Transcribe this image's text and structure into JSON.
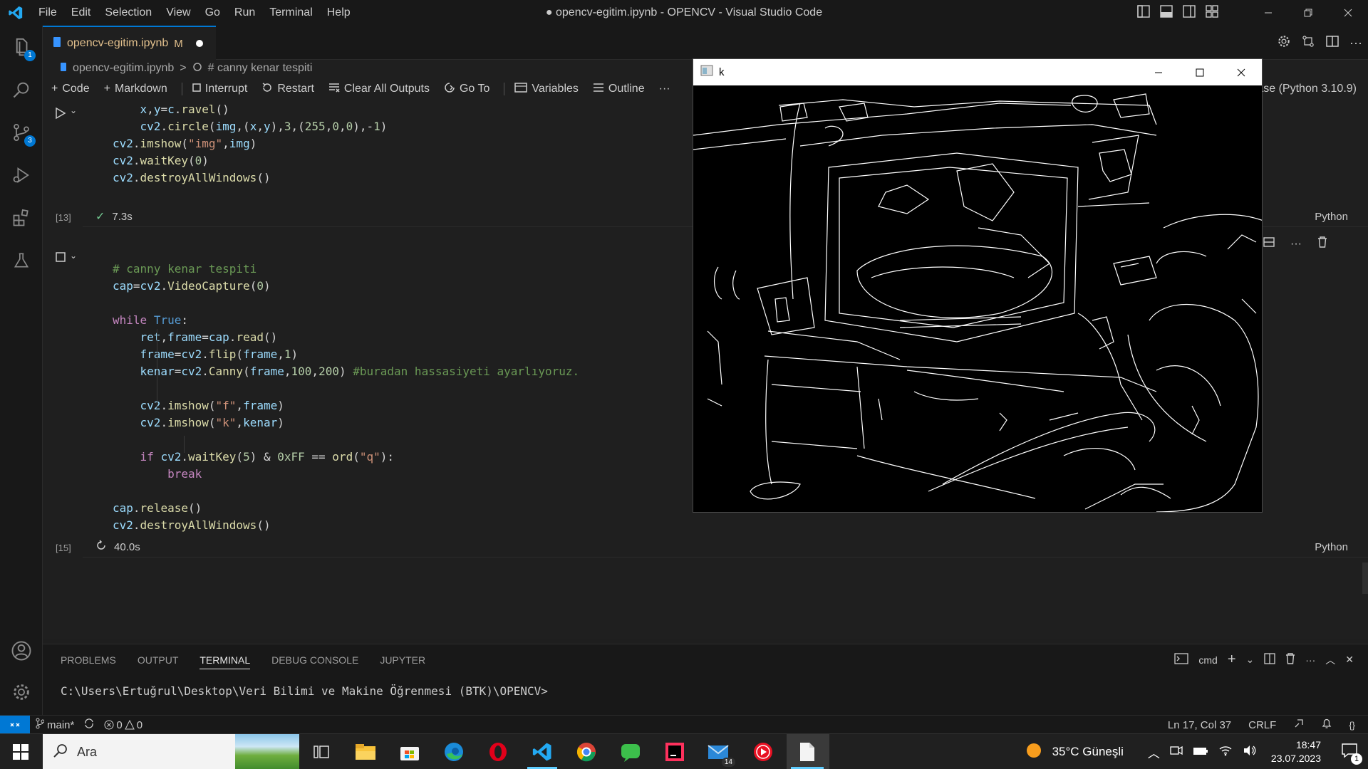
{
  "window": {
    "title": "● opencv-egitim.ipynb - OPENCV - Visual Studio Code",
    "menu": [
      "File",
      "Edit",
      "Selection",
      "View",
      "Go",
      "Run",
      "Terminal",
      "Help"
    ]
  },
  "activity_bar": {
    "explorer_badge": "1",
    "scm_badge": "3"
  },
  "tab": {
    "filename": "opencv-egitim.ipynb",
    "modified": "M"
  },
  "breadcrumb": {
    "file": "opencv-egitim.ipynb",
    "separator": ">",
    "section": "# canny kenar tespiti"
  },
  "toolbar": {
    "code": "Code",
    "markdown": "Markdown",
    "interrupt": "Interrupt",
    "restart": "Restart",
    "clear_all_outputs": "Clear All Outputs",
    "goto": "Go To",
    "variables": "Variables",
    "outline": "Outline",
    "more": "···",
    "kernel": "ase (Python 3.10.9)"
  },
  "cells": [
    {
      "exec_count": "[13]",
      "status": "7.3s",
      "language": "Python"
    },
    {
      "exec_count": "[15]",
      "status": "40.0s",
      "language": "Python"
    }
  ],
  "panel": {
    "tabs": [
      "PROBLEMS",
      "OUTPUT",
      "TERMINAL",
      "DEBUG CONSOLE",
      "JUPYTER"
    ],
    "active_tab": "TERMINAL",
    "shell": "cmd",
    "prompt": "C:\\Users\\Ertuğrul\\Desktop\\Veri Bilimi ve Makine Öğrenmesi (BTK)\\OPENCV>"
  },
  "statusbar": {
    "branch": "main*",
    "errors": "0",
    "warnings": "0",
    "position": "Ln 17, Col 37",
    "eol": "CRLF"
  },
  "cv_window": {
    "title": "k"
  },
  "taskbar": {
    "search_placeholder": "Ara",
    "mail_badge": "14",
    "weather": "35°C  Güneşli",
    "time": "18:47",
    "date": "23.07.2023",
    "notification_count": "1"
  }
}
